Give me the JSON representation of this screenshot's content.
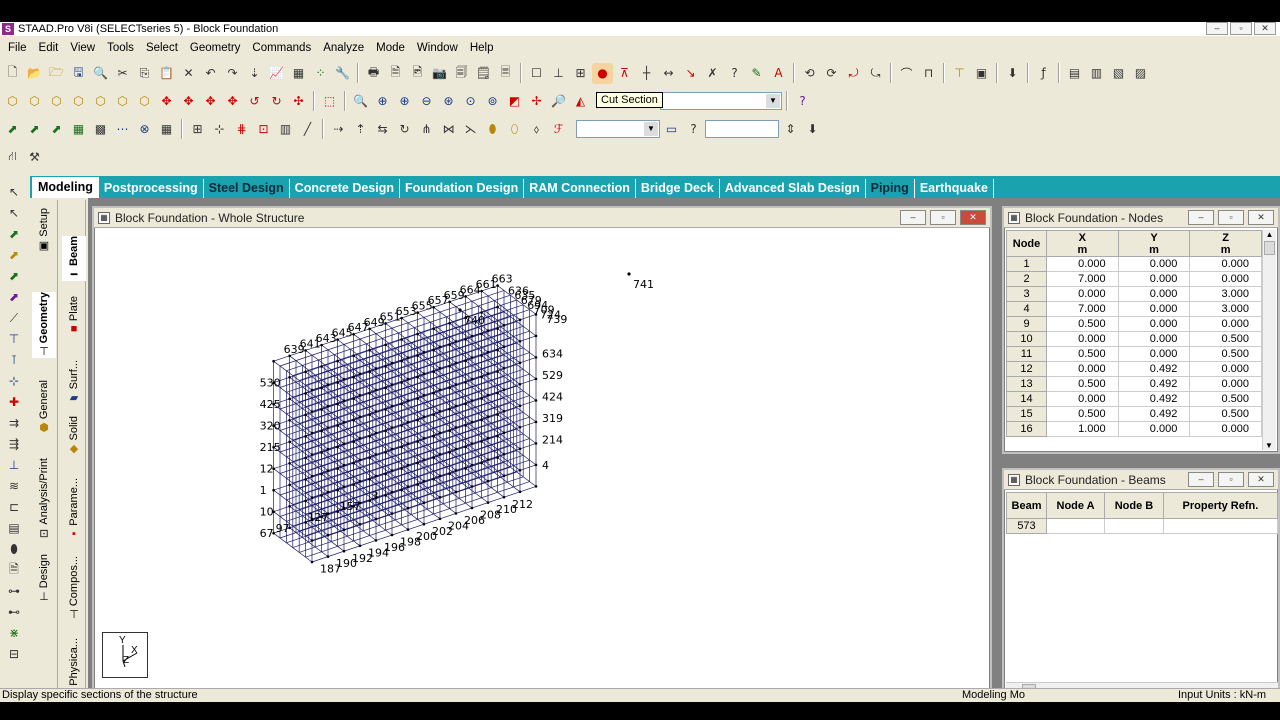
{
  "app": {
    "title": "STAAD.Pro V8i (SELECTseries 5) - Block Foundation"
  },
  "window_buttons": [
    "–",
    "▫",
    "✕"
  ],
  "menu": [
    "File",
    "Edit",
    "View",
    "Tools",
    "Select",
    "Geometry",
    "Commands",
    "Analyze",
    "Mode",
    "Window",
    "Help"
  ],
  "tooltip": "Cut Section",
  "page_tabs": [
    "Modeling",
    "Postprocessing",
    "Steel Design",
    "Concrete Design",
    "Foundation Design",
    "RAM Connection",
    "Bridge Deck",
    "Advanced Slab Design",
    "Piping",
    "Earthquake"
  ],
  "vertical_tabs": [
    "Setup",
    "Geometry",
    "General",
    "Analysis/Print",
    "Design"
  ],
  "vertical_tabs2": [
    "Beam",
    "Plate",
    "Surf...",
    "Solid",
    "Parame...",
    "Compos...",
    "Physica..."
  ],
  "structure_window": {
    "title": "Block Foundation - Whole Structure"
  },
  "nodes_window": {
    "title": "Block Foundation - Nodes",
    "columns": [
      {
        "name": "Node",
        "unit": ""
      },
      {
        "name": "X",
        "unit": "m"
      },
      {
        "name": "Y",
        "unit": "m"
      },
      {
        "name": "Z",
        "unit": "m"
      }
    ],
    "rows": [
      [
        "1",
        "0.000",
        "0.000",
        "0.000"
      ],
      [
        "2",
        "7.000",
        "0.000",
        "0.000"
      ],
      [
        "3",
        "0.000",
        "0.000",
        "3.000"
      ],
      [
        "4",
        "7.000",
        "0.000",
        "3.000"
      ],
      [
        "9",
        "0.500",
        "0.000",
        "0.000"
      ],
      [
        "10",
        "0.000",
        "0.000",
        "0.500"
      ],
      [
        "11",
        "0.500",
        "0.000",
        "0.500"
      ],
      [
        "12",
        "0.000",
        "0.492",
        "0.000"
      ],
      [
        "13",
        "0.500",
        "0.492",
        "0.000"
      ],
      [
        "14",
        "0.000",
        "0.492",
        "0.500"
      ],
      [
        "15",
        "0.500",
        "0.492",
        "0.500"
      ],
      [
        "16",
        "1.000",
        "0.000",
        "0.000"
      ]
    ]
  },
  "beams_window": {
    "title": "Block Foundation - Beams",
    "columns": [
      "Beam",
      "Node A",
      "Node B",
      "Property Refn."
    ],
    "rows": [
      [
        "573",
        "",
        "",
        ""
      ]
    ]
  },
  "axis_triad": {
    "y": "Y",
    "x": "X",
    "z": "Z"
  },
  "node_labels": {
    "top": [
      "741",
      "740",
      "663",
      "661",
      "664",
      "659",
      "657",
      "655",
      "653",
      "651",
      "649",
      "647",
      "645",
      "643",
      "641",
      "639",
      "636",
      "635",
      "679",
      "694",
      "709",
      "724",
      "739"
    ],
    "right": [
      "634",
      "529",
      "424",
      "319",
      "214",
      "4"
    ],
    "left": [
      "530",
      "425",
      "320",
      "215",
      "12",
      "1",
      "10",
      "67",
      "97",
      "127",
      "157",
      "3"
    ],
    "bottom": [
      "187",
      "190",
      "192",
      "194",
      "196",
      "198",
      "200",
      "202",
      "204",
      "206",
      "208",
      "210",
      "212"
    ]
  },
  "status": {
    "left": "Display specific sections of the structure",
    "mode": "Modeling Mo",
    "units": "Input Units : kN-m"
  }
}
